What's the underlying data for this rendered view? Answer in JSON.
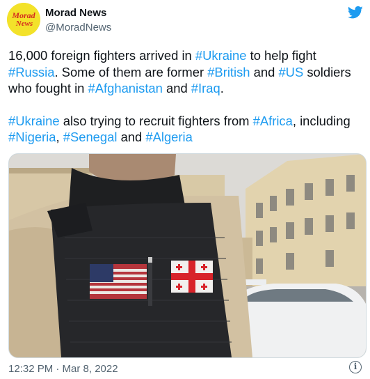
{
  "author": {
    "display_name": "Morad News",
    "handle": "@MoradNews",
    "avatar_text_line1": "Morad",
    "avatar_text_line2": "News",
    "avatar_color": "#f3e22a"
  },
  "brand_icon": "twitter-bird-icon",
  "tweet": {
    "p1": {
      "t1": "16,000 foreign fighters arrived in ",
      "h1": "#Ukraine",
      "t2": " to help fight ",
      "h2": "#Russia",
      "t3": ". Some of them are former ",
      "h3": "#British",
      "t4": " and ",
      "h4": "#US",
      "t5": " soldiers who fought in ",
      "h5": "#Afghanistan",
      "t6": " and ",
      "h6": "#Iraq",
      "t7": "."
    },
    "p2": {
      "h1": "#Ukraine",
      "t1": " also trying to recruit fighters from ",
      "h2": "#Africa",
      "t2": ", including ",
      "h3": "#Nigeria",
      "t3": ", ",
      "h4": "#Senegal",
      "t4": " and ",
      "h5": "#Algeria"
    }
  },
  "timestamp": "12:32 PM · Mar 8, 2022",
  "info_icon": "info-icon",
  "colors": {
    "hashtag": "#1d9bf0",
    "text": "#0f1419",
    "secondary": "#536471",
    "twitter_blue": "#1d9bf0"
  }
}
